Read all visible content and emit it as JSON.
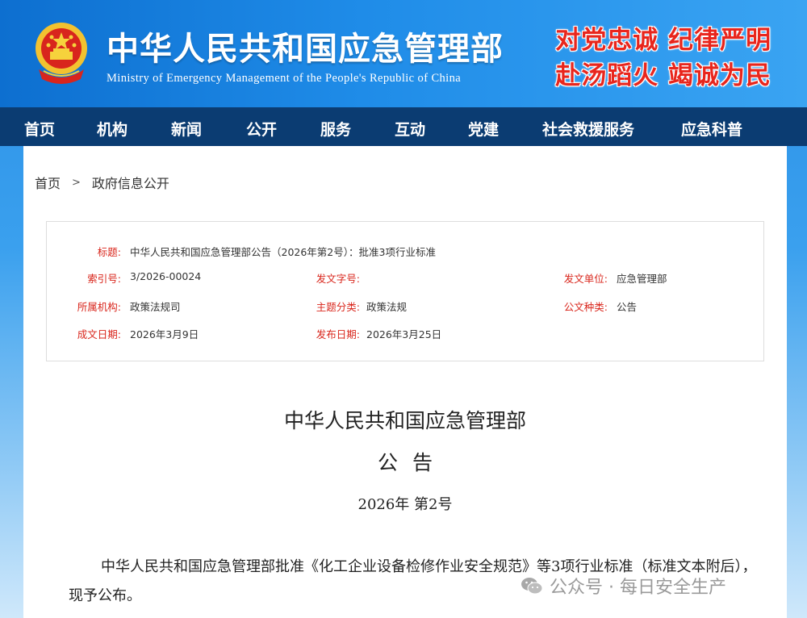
{
  "header": {
    "title": "中华人民共和国应急管理部",
    "subtitle": "Ministry of Emergency Management of the People's Republic of China",
    "slogan_line1": "对党忠诚 纪律严明",
    "slogan_line2": "赴汤蹈火 竭诚为民"
  },
  "nav": {
    "items": [
      "首页",
      "机构",
      "新闻",
      "公开",
      "服务",
      "互动",
      "党建",
      "社会救援服务",
      "应急科普"
    ]
  },
  "breadcrumb": {
    "home": "首页",
    "separator": ">",
    "current": "政府信息公开"
  },
  "meta": {
    "title_label": "标题:",
    "title_value": "中华人民共和国应急管理部公告（2026年第2号）：批准3项行业标准",
    "index_label": "索引号:",
    "index_value": "3/2026-00024",
    "doc_no_label": "发文字号:",
    "doc_no_value": "",
    "issuer_label": "发文单位:",
    "issuer_value": "应急管理部",
    "org_label": "所属机构:",
    "org_value": "政策法规司",
    "topic_label": "主题分类:",
    "topic_value": "政策法规",
    "type_label": "公文种类:",
    "type_value": "公告",
    "written_label": "成文日期:",
    "written_value": "2026年3月9日",
    "published_label": "发布日期:",
    "published_value": "2026年3月25日"
  },
  "document": {
    "heading": "中华人民共和国应急管理部",
    "subheading": "公告",
    "number": "2026年  第2号",
    "body": "中华人民共和国应急管理部批准《化工企业设备检修作业安全规范》等3项行业标准（标准文本附后），现予公布。"
  },
  "watermark": {
    "text": "公众号 · 每日安全生产"
  },
  "colors": {
    "nav_bg": "#0b3c72",
    "label_red": "#d9261c",
    "slogan_red": "#e8261d",
    "header_blue": "#1f8ce8"
  }
}
